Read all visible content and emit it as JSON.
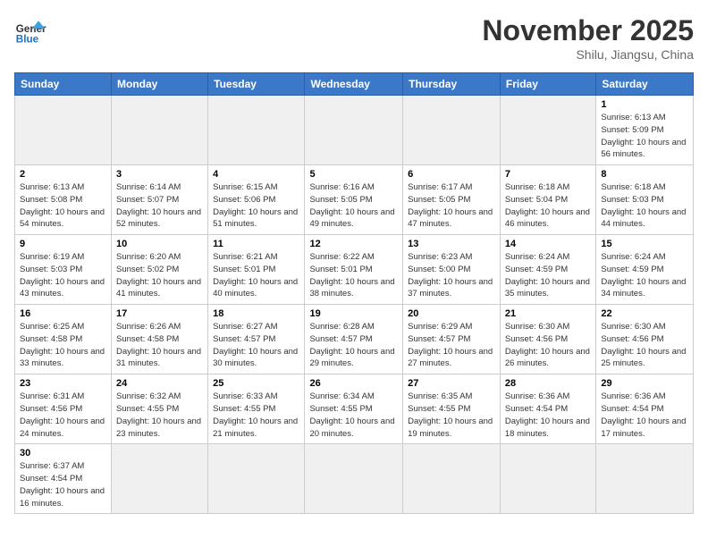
{
  "header": {
    "logo_general": "General",
    "logo_blue": "Blue",
    "title": "November 2025",
    "subtitle": "Shilu, Jiangsu, China"
  },
  "weekdays": [
    "Sunday",
    "Monday",
    "Tuesday",
    "Wednesday",
    "Thursday",
    "Friday",
    "Saturday"
  ],
  "weeks": [
    [
      {
        "day": "",
        "info": ""
      },
      {
        "day": "",
        "info": ""
      },
      {
        "day": "",
        "info": ""
      },
      {
        "day": "",
        "info": ""
      },
      {
        "day": "",
        "info": ""
      },
      {
        "day": "",
        "info": ""
      },
      {
        "day": "1",
        "info": "Sunrise: 6:13 AM\nSunset: 5:09 PM\nDaylight: 10 hours and 56 minutes."
      }
    ],
    [
      {
        "day": "2",
        "info": "Sunrise: 6:13 AM\nSunset: 5:08 PM\nDaylight: 10 hours and 54 minutes."
      },
      {
        "day": "3",
        "info": "Sunrise: 6:14 AM\nSunset: 5:07 PM\nDaylight: 10 hours and 52 minutes."
      },
      {
        "day": "4",
        "info": "Sunrise: 6:15 AM\nSunset: 5:06 PM\nDaylight: 10 hours and 51 minutes."
      },
      {
        "day": "5",
        "info": "Sunrise: 6:16 AM\nSunset: 5:05 PM\nDaylight: 10 hours and 49 minutes."
      },
      {
        "day": "6",
        "info": "Sunrise: 6:17 AM\nSunset: 5:05 PM\nDaylight: 10 hours and 47 minutes."
      },
      {
        "day": "7",
        "info": "Sunrise: 6:18 AM\nSunset: 5:04 PM\nDaylight: 10 hours and 46 minutes."
      },
      {
        "day": "8",
        "info": "Sunrise: 6:18 AM\nSunset: 5:03 PM\nDaylight: 10 hours and 44 minutes."
      }
    ],
    [
      {
        "day": "9",
        "info": "Sunrise: 6:19 AM\nSunset: 5:03 PM\nDaylight: 10 hours and 43 minutes."
      },
      {
        "day": "10",
        "info": "Sunrise: 6:20 AM\nSunset: 5:02 PM\nDaylight: 10 hours and 41 minutes."
      },
      {
        "day": "11",
        "info": "Sunrise: 6:21 AM\nSunset: 5:01 PM\nDaylight: 10 hours and 40 minutes."
      },
      {
        "day": "12",
        "info": "Sunrise: 6:22 AM\nSunset: 5:01 PM\nDaylight: 10 hours and 38 minutes."
      },
      {
        "day": "13",
        "info": "Sunrise: 6:23 AM\nSunset: 5:00 PM\nDaylight: 10 hours and 37 minutes."
      },
      {
        "day": "14",
        "info": "Sunrise: 6:24 AM\nSunset: 4:59 PM\nDaylight: 10 hours and 35 minutes."
      },
      {
        "day": "15",
        "info": "Sunrise: 6:24 AM\nSunset: 4:59 PM\nDaylight: 10 hours and 34 minutes."
      }
    ],
    [
      {
        "day": "16",
        "info": "Sunrise: 6:25 AM\nSunset: 4:58 PM\nDaylight: 10 hours and 33 minutes."
      },
      {
        "day": "17",
        "info": "Sunrise: 6:26 AM\nSunset: 4:58 PM\nDaylight: 10 hours and 31 minutes."
      },
      {
        "day": "18",
        "info": "Sunrise: 6:27 AM\nSunset: 4:57 PM\nDaylight: 10 hours and 30 minutes."
      },
      {
        "day": "19",
        "info": "Sunrise: 6:28 AM\nSunset: 4:57 PM\nDaylight: 10 hours and 29 minutes."
      },
      {
        "day": "20",
        "info": "Sunrise: 6:29 AM\nSunset: 4:57 PM\nDaylight: 10 hours and 27 minutes."
      },
      {
        "day": "21",
        "info": "Sunrise: 6:30 AM\nSunset: 4:56 PM\nDaylight: 10 hours and 26 minutes."
      },
      {
        "day": "22",
        "info": "Sunrise: 6:30 AM\nSunset: 4:56 PM\nDaylight: 10 hours and 25 minutes."
      }
    ],
    [
      {
        "day": "23",
        "info": "Sunrise: 6:31 AM\nSunset: 4:56 PM\nDaylight: 10 hours and 24 minutes."
      },
      {
        "day": "24",
        "info": "Sunrise: 6:32 AM\nSunset: 4:55 PM\nDaylight: 10 hours and 23 minutes."
      },
      {
        "day": "25",
        "info": "Sunrise: 6:33 AM\nSunset: 4:55 PM\nDaylight: 10 hours and 21 minutes."
      },
      {
        "day": "26",
        "info": "Sunrise: 6:34 AM\nSunset: 4:55 PM\nDaylight: 10 hours and 20 minutes."
      },
      {
        "day": "27",
        "info": "Sunrise: 6:35 AM\nSunset: 4:55 PM\nDaylight: 10 hours and 19 minutes."
      },
      {
        "day": "28",
        "info": "Sunrise: 6:36 AM\nSunset: 4:54 PM\nDaylight: 10 hours and 18 minutes."
      },
      {
        "day": "29",
        "info": "Sunrise: 6:36 AM\nSunset: 4:54 PM\nDaylight: 10 hours and 17 minutes."
      }
    ],
    [
      {
        "day": "30",
        "info": "Sunrise: 6:37 AM\nSunset: 4:54 PM\nDaylight: 10 hours and 16 minutes."
      },
      {
        "day": "",
        "info": ""
      },
      {
        "day": "",
        "info": ""
      },
      {
        "day": "",
        "info": ""
      },
      {
        "day": "",
        "info": ""
      },
      {
        "day": "",
        "info": ""
      },
      {
        "day": "",
        "info": ""
      }
    ]
  ]
}
